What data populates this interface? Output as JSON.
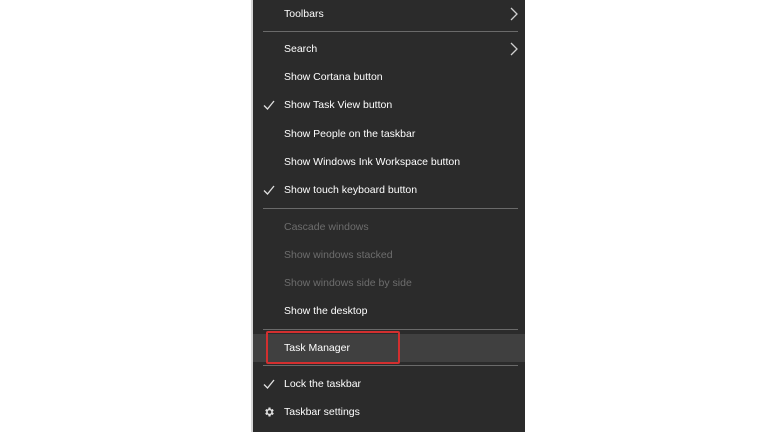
{
  "menu": {
    "items": [
      {
        "id": "toolbars",
        "label": "Toolbars",
        "submenu": true,
        "checked": false,
        "enabled": true
      },
      {
        "id": "search",
        "label": "Search",
        "submenu": true,
        "checked": false,
        "enabled": true
      },
      {
        "id": "show-cortana-button",
        "label": "Show Cortana button",
        "submenu": false,
        "checked": false,
        "enabled": true
      },
      {
        "id": "show-task-view-button",
        "label": "Show Task View button",
        "submenu": false,
        "checked": true,
        "enabled": true
      },
      {
        "id": "show-people",
        "label": "Show People on the taskbar",
        "submenu": false,
        "checked": false,
        "enabled": true
      },
      {
        "id": "show-windows-ink",
        "label": "Show Windows Ink Workspace button",
        "submenu": false,
        "checked": false,
        "enabled": true
      },
      {
        "id": "show-touch-keyboard",
        "label": "Show touch keyboard button",
        "submenu": false,
        "checked": true,
        "enabled": true
      },
      {
        "id": "cascade-windows",
        "label": "Cascade windows",
        "submenu": false,
        "checked": false,
        "enabled": false
      },
      {
        "id": "show-windows-stacked",
        "label": "Show windows stacked",
        "submenu": false,
        "checked": false,
        "enabled": false
      },
      {
        "id": "show-windows-side-by-side",
        "label": "Show windows side by side",
        "submenu": false,
        "checked": false,
        "enabled": false
      },
      {
        "id": "show-the-desktop",
        "label": "Show the desktop",
        "submenu": false,
        "checked": false,
        "enabled": true
      },
      {
        "id": "task-manager",
        "label": "Task Manager",
        "submenu": false,
        "checked": false,
        "enabled": true,
        "highlighted": true
      },
      {
        "id": "lock-the-taskbar",
        "label": "Lock the taskbar",
        "submenu": false,
        "checked": true,
        "enabled": true
      },
      {
        "id": "taskbar-settings",
        "label": "Taskbar settings",
        "submenu": false,
        "checked": false,
        "enabled": true,
        "icon": "gear-icon"
      }
    ]
  },
  "colors": {
    "menu_background": "#2b2b2b",
    "hover_background": "#404040",
    "text": "#ffffff",
    "disabled_text": "#6d6d6d",
    "separator": "#6a6a6a",
    "highlight_border": "#d32f2f"
  }
}
